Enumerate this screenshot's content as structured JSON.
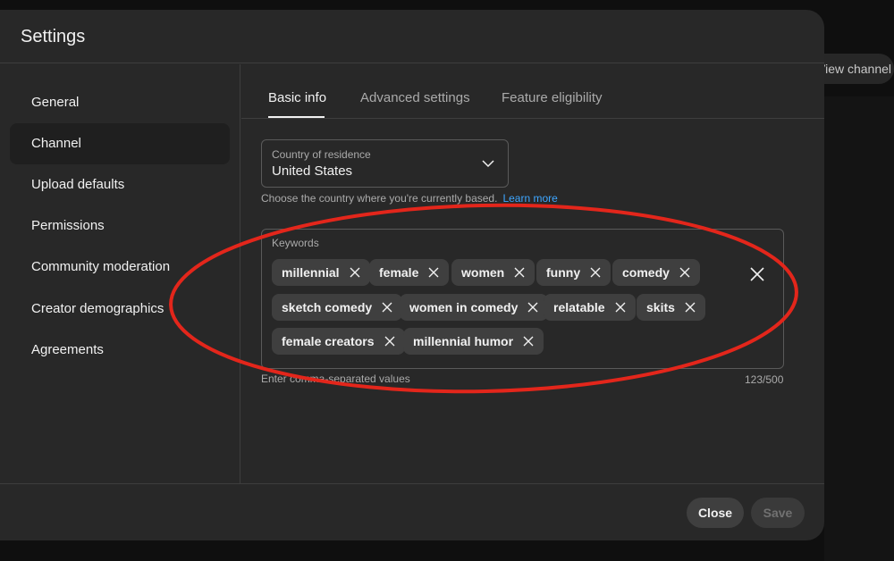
{
  "background": {
    "view_channel_label": "View channel"
  },
  "dialog": {
    "title": "Settings"
  },
  "sidebar": {
    "items": [
      {
        "label": "General"
      },
      {
        "label": "Channel",
        "active": true
      },
      {
        "label": "Upload defaults"
      },
      {
        "label": "Permissions"
      },
      {
        "label": "Community moderation"
      },
      {
        "label": "Creator demographics"
      },
      {
        "label": "Agreements"
      }
    ]
  },
  "tabs": [
    {
      "label": "Basic info",
      "active": true
    },
    {
      "label": "Advanced settings"
    },
    {
      "label": "Feature eligibility"
    }
  ],
  "country": {
    "label": "Country of residence",
    "value": "United States",
    "help": "Choose the country where you're currently based.",
    "learn_more": "Learn more",
    "icon": "chevron-down-icon"
  },
  "keywords": {
    "label": "Keywords",
    "chips": [
      "millennial",
      "female",
      "women",
      "funny",
      "comedy",
      "sketch comedy",
      "women in comedy",
      "relatable",
      "skits",
      "female creators",
      "millennial humor"
    ],
    "help": "Enter comma-separated values",
    "count": "123/500",
    "clear_icon": "close-icon"
  },
  "footer": {
    "close_label": "Close",
    "save_label": "Save"
  },
  "colors": {
    "dialog_bg": "#282828",
    "chip_bg": "#3f3f3f",
    "link": "#3ea6ff",
    "annotation": "#e3261b"
  }
}
